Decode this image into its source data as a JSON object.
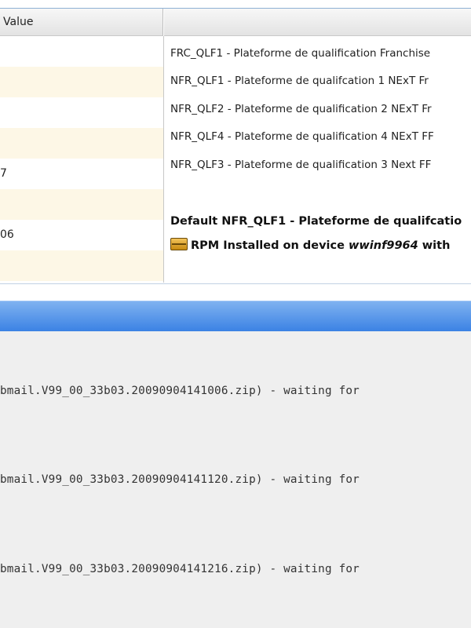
{
  "table": {
    "header_value": "Value",
    "header_other": "",
    "left_values": [
      "",
      "",
      "",
      "",
      "7",
      "",
      "06",
      ""
    ],
    "descriptions": [
      "FRC_QLF1 - Plateforme de qualification Franchise",
      "NFR_QLF1 - Plateforme de qualifcation 1 NExT Fr",
      "NFR_QLF2 - Plateforme de qualification 2 NExT Fr",
      "NFR_QLF4 - Plateforme de qualification 4 NExT FF",
      "NFR_QLF3 - Plateforme de qualification 3 Next FF"
    ],
    "default_line": "Default NFR_QLF1 - Plateforme de qualifcatio",
    "rpm_prefix": "RPM Installed on device ",
    "rpm_device": "wwinf9964",
    "rpm_suffix": " with"
  },
  "log": {
    "lines": [
      "bmail.V99_00_33b03.20090904141006.zip) - waiting for",
      "bmail.V99_00_33b03.20090904141120.zip) - waiting for",
      "bmail.V99_00_33b03.20090904141216.zip) - waiting for"
    ]
  },
  "icons": {
    "package": "package-icon"
  },
  "colors": {
    "row_alt": "#fdf7e6",
    "blue_bar": "#3b82e4",
    "log_bg": "#efefef"
  }
}
